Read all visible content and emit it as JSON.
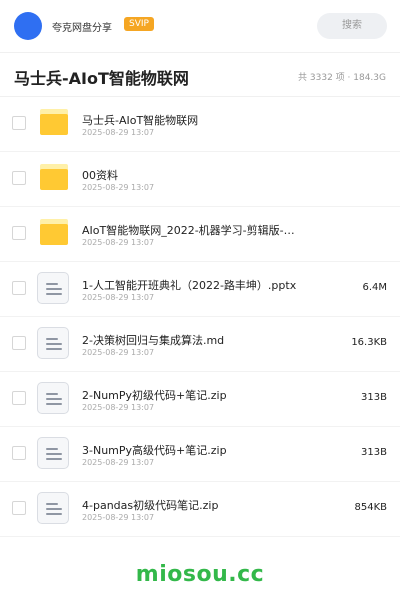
{
  "topbar": {
    "app_name": "夸克网盘分享",
    "vip_label": "SVIP",
    "search_label": "搜索"
  },
  "folder": {
    "title": "马士兵-AIoT智能物联网",
    "stats": "共 3332 项 · 184.3G"
  },
  "files": [
    {
      "type": "folder",
      "name": "马士兵-AIoT智能物联网",
      "date": "2025-08-29 13:07",
      "size": ""
    },
    {
      "type": "folder",
      "name": "00资料",
      "date": "2025-08-29 13:07",
      "size": ""
    },
    {
      "type": "folder",
      "name": "AIoT智能物联网_2022-机器学习-剪辑版-路…",
      "date": "2025-08-29 13:07",
      "size": ""
    },
    {
      "type": "file",
      "name": "1-人工智能开班典礼（2022-路丰坤）.pptx",
      "date": "2025-08-29 13:07",
      "size": "6.4M"
    },
    {
      "type": "file",
      "name": "2-决策树回归与集成算法.md",
      "date": "2025-08-29 13:07",
      "size": "16.3KB"
    },
    {
      "type": "file",
      "name": "2-NumPy初级代码+笔记.zip",
      "date": "2025-08-29 13:07",
      "size": "313B"
    },
    {
      "type": "file",
      "name": "3-NumPy高级代码+笔记.zip",
      "date": "2025-08-29 13:07",
      "size": "313B"
    },
    {
      "type": "file",
      "name": "4-pandas初级代码笔记.zip",
      "date": "2025-08-29 13:07",
      "size": "854KB"
    }
  ],
  "watermark": "miosou.cc",
  "colors": {
    "avatar": "#2f6ff2",
    "vip_badge": "#f5a623",
    "folder": "#ffc933",
    "watermark": "#33b84a"
  }
}
